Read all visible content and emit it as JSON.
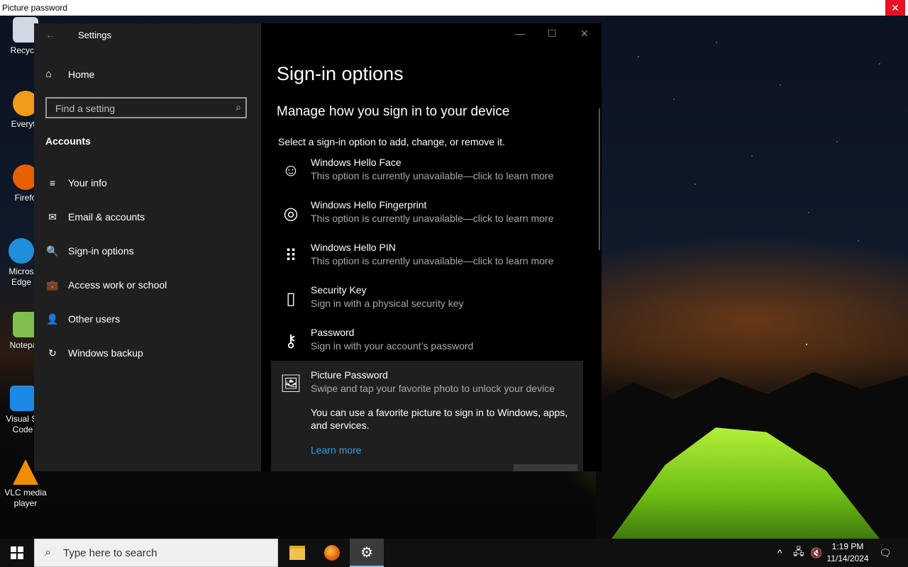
{
  "picture_password_bar": {
    "title": "Picture password",
    "close": "✕"
  },
  "desktop_icons": [
    {
      "label": "Recycle",
      "color": "#cfd8e3"
    },
    {
      "label": "Everyth",
      "color": "#f29b1d"
    },
    {
      "label": "Firefo",
      "color": "#e66000"
    },
    {
      "label": "Micros Edge",
      "color": "#1f8fdc"
    },
    {
      "label": "Notepac",
      "color": "#7fbf4f"
    },
    {
      "label": "Visual St Code",
      "color": "#1e88e5"
    },
    {
      "label": "VLC media player",
      "color": "#f28c00"
    }
  ],
  "settings": {
    "app_title": "Settings",
    "back": "←",
    "window_controls": {
      "minimize": "—",
      "maximize": "☐",
      "close": "✕"
    },
    "home": "Home",
    "search_placeholder": "Find a setting",
    "section_title": "Accounts",
    "nav_items": [
      {
        "label": "Your info",
        "icon": "≡"
      },
      {
        "label": "Email & accounts",
        "icon": "✉"
      },
      {
        "label": "Sign-in options",
        "icon": "🔍"
      },
      {
        "label": "Access work or school",
        "icon": "💼"
      },
      {
        "label": "Other users",
        "icon": "👤"
      },
      {
        "label": "Windows backup",
        "icon": "↻"
      }
    ],
    "page_title": "Sign-in options",
    "subtitle": "Manage how you sign in to your device",
    "description": "Select a sign-in option to add, change, or remove it.",
    "options": [
      {
        "title": "Windows Hello Face",
        "subtitle": "This option is currently unavailable—click to learn more",
        "icon": "☺"
      },
      {
        "title": "Windows Hello Fingerprint",
        "subtitle": "This option is currently unavailable—click to learn more",
        "icon": "◎"
      },
      {
        "title": "Windows Hello PIN",
        "subtitle": "This option is currently unavailable—click to learn more",
        "icon": "⠿"
      },
      {
        "title": "Security Key",
        "subtitle": "Sign in with a physical security key",
        "icon": "▯"
      },
      {
        "title": "Password",
        "subtitle": "Sign in with your account’s password",
        "icon": "⚷"
      },
      {
        "title": "Picture Password",
        "subtitle": "Swipe and tap your favorite photo to unlock your device",
        "icon": "🖼"
      }
    ],
    "picture_password_body": "You can use a favorite picture to sign in to Windows, apps, and services.",
    "learn_more": "Learn more"
  },
  "taskbar": {
    "search_placeholder": "Type here to search",
    "time": "1:19 PM",
    "date": "11/14/2024"
  }
}
